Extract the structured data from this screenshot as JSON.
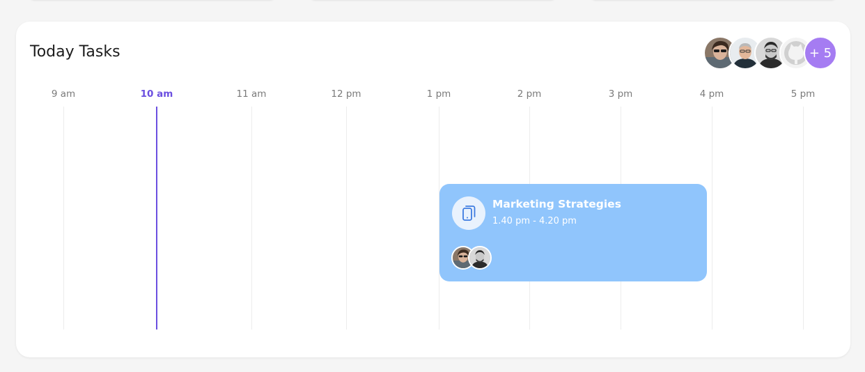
{
  "card": {
    "title": "Today Tasks"
  },
  "team_avatars": {
    "people": [
      "avatar-person-1",
      "avatar-person-2",
      "avatar-person-3",
      "avatar-github"
    ],
    "more_label": "+ 5"
  },
  "timeline": {
    "hours": [
      "9 am",
      "10 am",
      "11 am",
      "12 pm",
      "1 pm",
      "2 pm",
      "3 pm",
      "4 pm",
      "5 pm"
    ],
    "current_hour": "10 am"
  },
  "task": {
    "title": "Marketing Strategies",
    "time": "1.40 pm - 4.20 pm",
    "icon": "tablet-icon",
    "color": "#90c5fc",
    "assignees": [
      "avatar-person-1",
      "avatar-person-3"
    ]
  },
  "colors": {
    "accent": "#6b4fe0",
    "more_badge": "#a57cf2",
    "task_bg": "#90c5fc"
  }
}
